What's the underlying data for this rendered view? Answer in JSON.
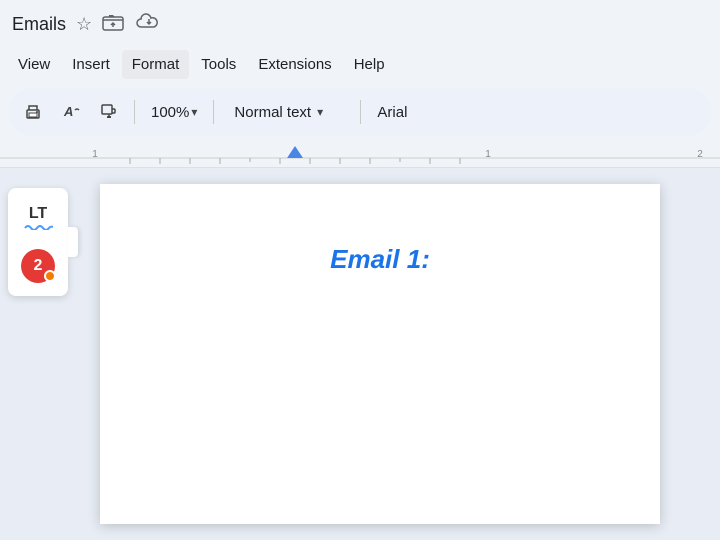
{
  "titleBar": {
    "title": "Emails",
    "icons": [
      "star",
      "folder-upload",
      "cloud"
    ]
  },
  "menuBar": {
    "items": [
      "View",
      "Insert",
      "Format",
      "Tools",
      "Extensions",
      "Help"
    ]
  },
  "toolbar": {
    "zoom": "100%",
    "zoomArrow": "▾",
    "textStyle": "Normal text",
    "textStyleArrow": "▾",
    "fontName": "Arial"
  },
  "ruler": {
    "marks": [
      -1,
      1,
      2
    ],
    "markerPosition": 295
  },
  "sidebar": {
    "ltLabel": "LT",
    "notifCount": "2"
  },
  "document": {
    "emailTitle": "Email 1:"
  },
  "colors": {
    "accent": "#1a73e8",
    "menuBg": "#f0f4f9",
    "toolbarBg": "#edf2fa",
    "rulerMarker": "#4a86e8"
  }
}
